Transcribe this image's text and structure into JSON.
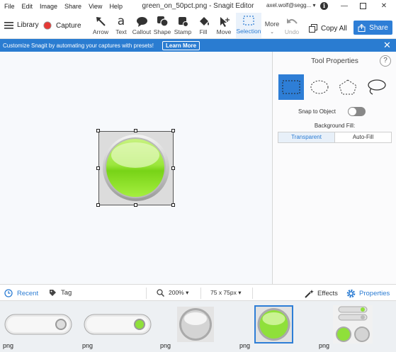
{
  "titlebar": {
    "menus": [
      "File",
      "Edit",
      "Image",
      "Share",
      "View",
      "Help"
    ],
    "title": "green_on_50pct.png - Snagit Editor",
    "account": "axel.wolf@segg... ▾",
    "info_icon": "i"
  },
  "toolbar": {
    "library_label": "Library",
    "capture_label": "Capture",
    "tools": [
      "Arrow",
      "Text",
      "Callout",
      "Shape",
      "Stamp",
      "Fill",
      "Move",
      "Selection",
      "More",
      "Undo"
    ],
    "copy_all_label": "Copy All",
    "share_label": "Share"
  },
  "banner": {
    "message": "Customize Snagit by automating your captures with presets!",
    "learn_more": "Learn More"
  },
  "properties": {
    "title": "Tool Properties",
    "help": "?",
    "snap_label": "Snap to Object",
    "background_fill_label": "Background Fill:",
    "fill_options": [
      "Transparent",
      "Auto-Fill"
    ],
    "snap_enabled": false
  },
  "bottombar": {
    "recent_label": "Recent",
    "tag_label": "Tag",
    "zoom": "200% ▾",
    "size": "75 x 75px ▾",
    "effects_label": "Effects",
    "properties_label": "Properties"
  },
  "tray": {
    "items": [
      {
        "label": "png"
      },
      {
        "label": "png"
      },
      {
        "label": "png"
      },
      {
        "label": "png"
      },
      {
        "label": "png"
      }
    ]
  },
  "colors": {
    "accent": "#2e7ed6",
    "green": "#8fe03a",
    "capture_red": "#e53935"
  }
}
